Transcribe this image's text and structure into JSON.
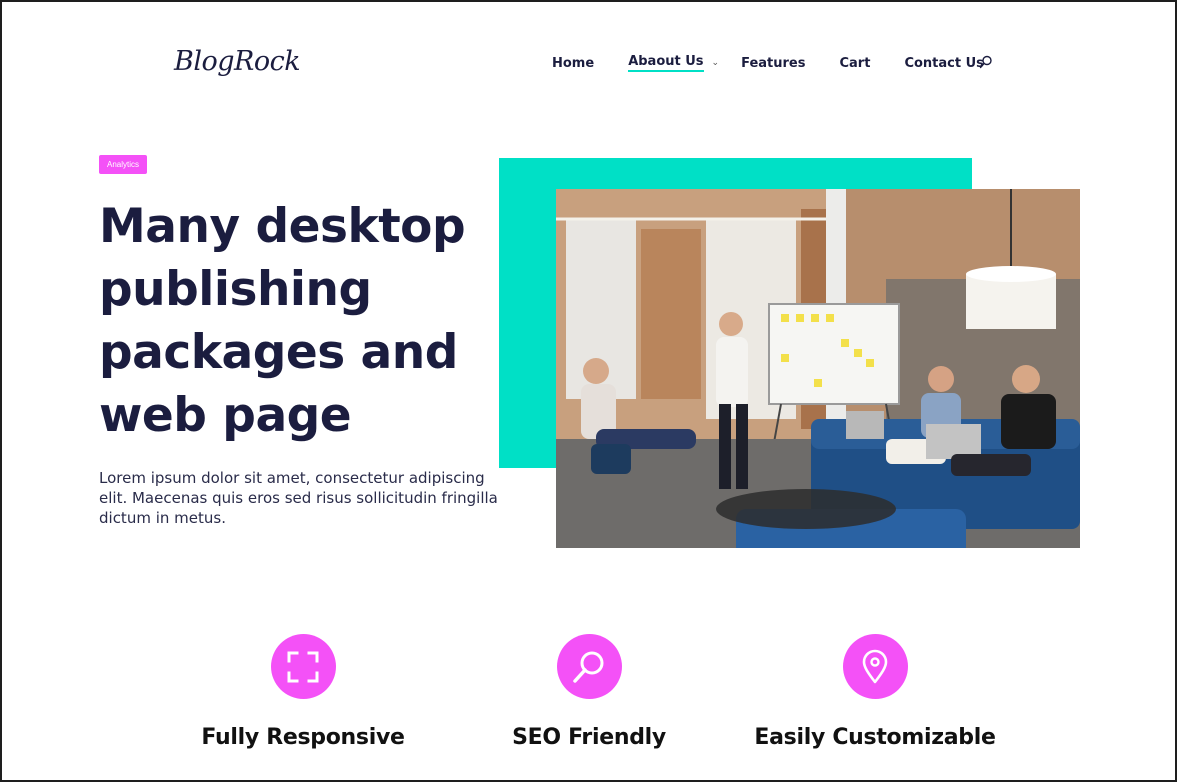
{
  "header": {
    "logo": "BlogRock",
    "nav": [
      {
        "label": "Home"
      },
      {
        "label": "Abaout Us"
      },
      {
        "label": "Features"
      },
      {
        "label": "Cart"
      },
      {
        "label": "Contact Us"
      }
    ]
  },
  "hero": {
    "badge": "Analytics",
    "title_lines": [
      "Many desktop",
      "publishing",
      "packages and",
      "web page"
    ],
    "text": "Lorem ipsum dolor sit amet, consectetur adipiscing elit. Maecenas quis eros sed risus sollicitudin fringilla dictum in metus."
  },
  "features": [
    {
      "title": "Fully Responsive",
      "icon": "expand-frame-icon"
    },
    {
      "title": "SEO Friendly",
      "icon": "magnifier-icon"
    },
    {
      "title": "Easily Customizable",
      "icon": "location-pin-icon"
    }
  ],
  "colors": {
    "accent_pink": "#f451f7",
    "accent_teal": "#00e0c6",
    "text_dark": "#1b1d3f"
  }
}
